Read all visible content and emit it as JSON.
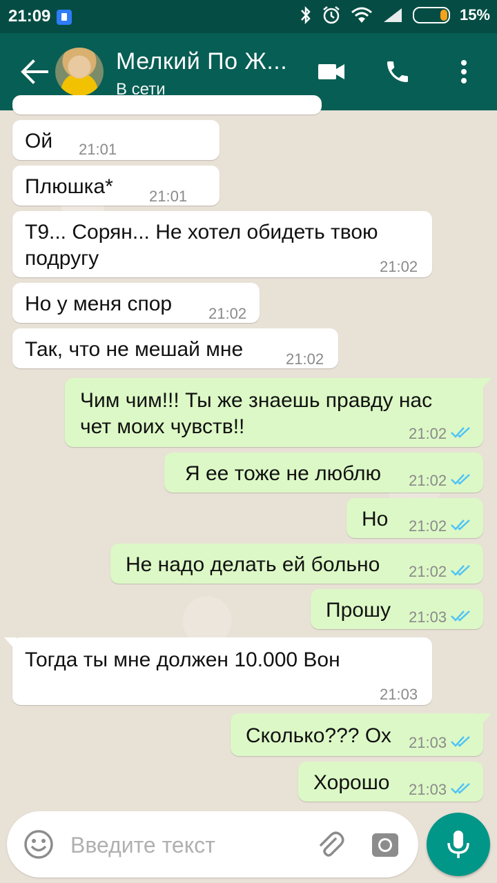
{
  "status_bar": {
    "time": "21:09",
    "battery": "15%"
  },
  "header": {
    "name": "Мелкий По Ж...",
    "status": "В сети"
  },
  "messages": [
    {
      "dir": "in",
      "text": "Ой",
      "time": "21:01"
    },
    {
      "dir": "in",
      "text": "Плюшка*",
      "time": "21:01"
    },
    {
      "dir": "in",
      "text": "Т9... Сорян... Не хотел обидеть твою подругу",
      "time": "21:02"
    },
    {
      "dir": "in",
      "text": "Но у меня спор",
      "time": "21:02"
    },
    {
      "dir": "in",
      "text": "Так, что не мешай мне",
      "time": "21:02"
    },
    {
      "dir": "out",
      "text": "Чим чим!!! Ты же знаешь правду нас чет моих чувств!!",
      "time": "21:02",
      "read": true
    },
    {
      "dir": "out",
      "text": "Я ее тоже не люблю",
      "time": "21:02",
      "read": true
    },
    {
      "dir": "out",
      "text": "Но",
      "time": "21:02",
      "read": true
    },
    {
      "dir": "out",
      "text": "Не надо делать ей больно",
      "time": "21:02",
      "read": true
    },
    {
      "dir": "out",
      "text": "Прошу",
      "time": "21:03",
      "read": true
    },
    {
      "dir": "in",
      "text": "Тогда ты мне должен 10.000 Вон",
      "time": "21:03"
    },
    {
      "dir": "out",
      "text": "Сколько??? Ох",
      "time": "21:03",
      "read": true
    },
    {
      "dir": "out",
      "text": "Хорошо",
      "time": "21:03",
      "read": true
    }
  ],
  "input": {
    "placeholder": "Введите текст"
  },
  "colors": {
    "header": "#075e54",
    "statusbar": "#054d44",
    "outgoing_bubble": "#dcf8c6",
    "incoming_bubble": "#ffffff",
    "read_ticks": "#4fc3f7",
    "mic_button": "#009688"
  },
  "icons": [
    "back-arrow-icon",
    "video-call-icon",
    "phone-icon",
    "more-vert-icon",
    "emoji-icon",
    "attach-icon",
    "camera-icon",
    "mic-icon",
    "double-check-icon"
  ]
}
